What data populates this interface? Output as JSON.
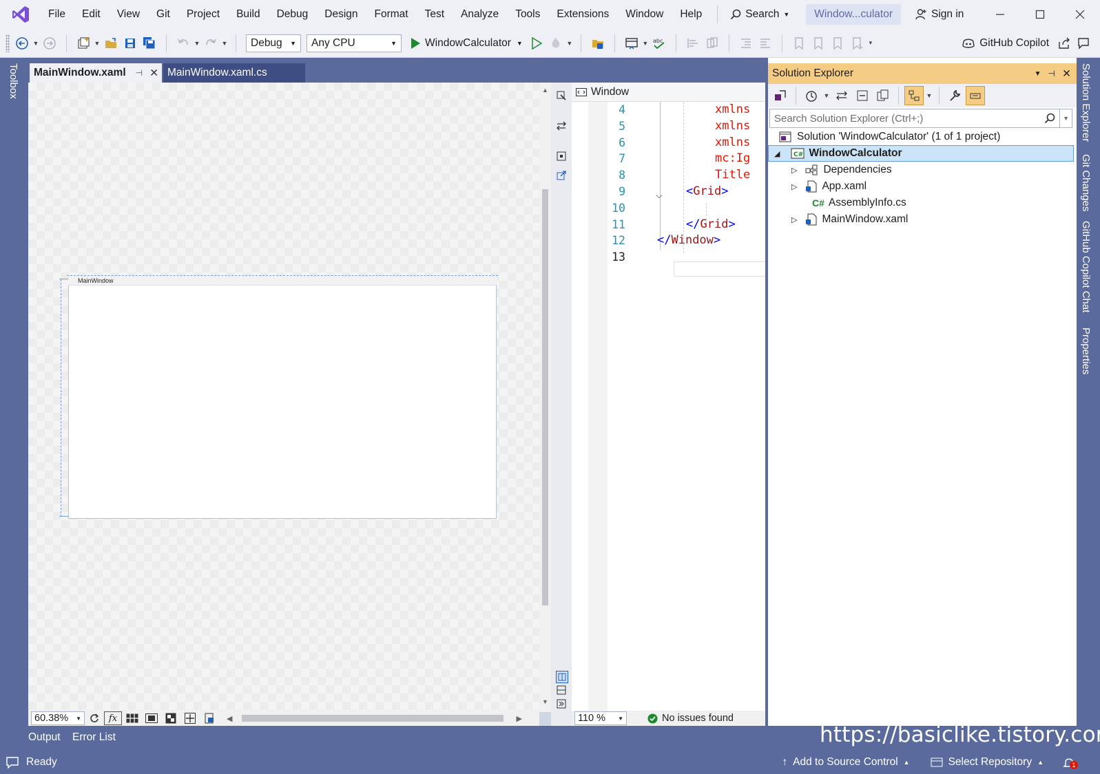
{
  "menu": [
    "File",
    "Edit",
    "View",
    "Git",
    "Project",
    "Build",
    "Debug",
    "Design",
    "Format",
    "Test",
    "Analyze",
    "Tools",
    "Extensions",
    "Window",
    "Help"
  ],
  "search_label": "Search",
  "solution_pill": "Window...culator",
  "sign_in": "Sign in",
  "toolbar": {
    "config": "Debug",
    "platform": "Any CPU",
    "run_target": "WindowCalculator",
    "copilot": "GitHub Copilot"
  },
  "left_sidebar": {
    "toolbox": "Toolbox"
  },
  "right_sidebar": [
    "Solution Explorer",
    "Git Changes",
    "GitHub Copilot Chat",
    "Properties"
  ],
  "doc_tabs": [
    {
      "label": "MainWindow.xaml",
      "active": true
    },
    {
      "label": "MainWindow.xaml.cs",
      "active": false
    }
  ],
  "designer": {
    "preview_title": "MainWindow",
    "zoom": "60.38%"
  },
  "editor": {
    "nav_element": "Window",
    "lines": [
      {
        "n": "4",
        "segments": [
          {
            "t": "xmlns",
            "c": "attr"
          }
        ]
      },
      {
        "n": "5",
        "segments": [
          {
            "t": "xmlns",
            "c": "attr"
          }
        ]
      },
      {
        "n": "6",
        "segments": [
          {
            "t": "xmlns",
            "c": "attr"
          }
        ]
      },
      {
        "n": "7",
        "segments": [
          {
            "t": "mc:Ig",
            "c": "attr"
          }
        ]
      },
      {
        "n": "8",
        "segments": [
          {
            "t": "Title",
            "c": "attr"
          }
        ]
      },
      {
        "n": "9",
        "segments": [
          {
            "t": "<",
            "c": "tag"
          },
          {
            "t": "Grid",
            "c": "tagname"
          },
          {
            "t": ">",
            "c": "tag"
          }
        ]
      },
      {
        "n": "10",
        "segments": []
      },
      {
        "n": "11",
        "segments": [
          {
            "t": "</",
            "c": "tag"
          },
          {
            "t": "Grid",
            "c": "tagname"
          },
          {
            "t": ">",
            "c": "tag"
          }
        ]
      },
      {
        "n": "12",
        "segments": [
          {
            "t": "</",
            "c": "tag"
          },
          {
            "t": "Window",
            "c": "tagname"
          },
          {
            "t": ">",
            "c": "tag"
          }
        ]
      },
      {
        "n": "13",
        "segments": []
      }
    ],
    "zoom": "110 %",
    "issues": "No issues found"
  },
  "solution_explorer": {
    "title": "Solution Explorer",
    "search_placeholder": "Search Solution Explorer (Ctrl+;)",
    "tree": [
      {
        "label": "Solution 'WindowCalculator' (1 of 1 project)",
        "icon": "solution-icon"
      },
      {
        "label": "WindowCalculator",
        "icon": "csharp-project-icon",
        "selected": true,
        "expanded": true
      },
      {
        "label": "Dependencies",
        "icon": "dependencies-icon"
      },
      {
        "label": "App.xaml",
        "icon": "xaml-file-icon"
      },
      {
        "label": "AssemblyInfo.cs",
        "icon": "csharp-file-icon"
      },
      {
        "label": "MainWindow.xaml",
        "icon": "xaml-file-icon"
      }
    ]
  },
  "bottom_tabs": [
    "Output",
    "Error List"
  ],
  "watermark": "https://basiclike.tistory.com",
  "status": {
    "ready": "Ready",
    "add_source": "Add to Source Control",
    "select_repo": "Select Repository",
    "notif_count": "1"
  },
  "colors": {
    "frame": "#5b6a9c",
    "se_header": "#f5cc84",
    "accent_purple": "#68217a",
    "run_green": "#1e8a2e"
  }
}
